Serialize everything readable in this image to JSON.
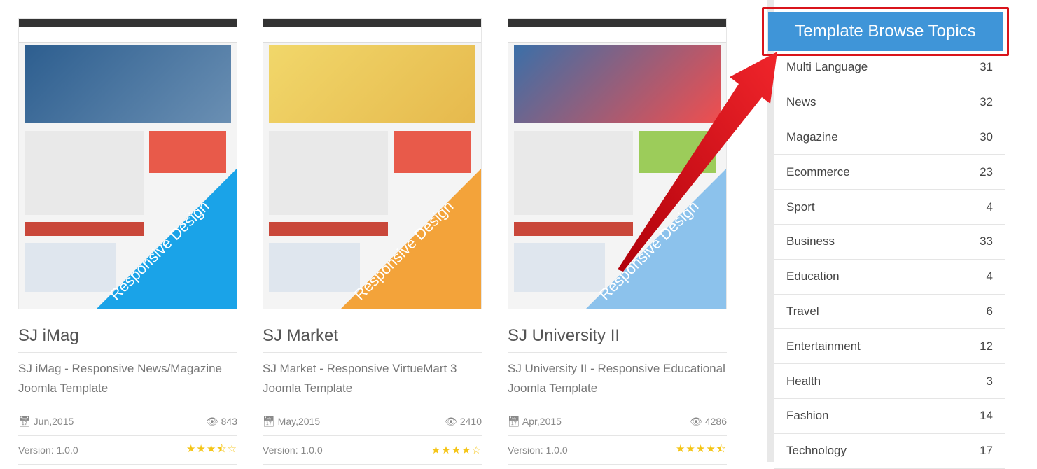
{
  "templates": [
    {
      "title": "SJ iMag",
      "description": "SJ iMag - Responsive News/Magazine Joomla Template",
      "date": "Jun,2015",
      "views": "843",
      "version": "Version: 1.0.0",
      "rating": 3.5,
      "badge": "Responsive Design",
      "badge_color": "#1aa3e8"
    },
    {
      "title": "SJ Market",
      "description": "SJ Market - Responsive VirtueMart 3 Joomla Template",
      "date": "May,2015",
      "views": "2410",
      "version": "Version: 1.0.0",
      "rating": 4,
      "badge": "Responsive Design",
      "badge_color": "#f3a33a"
    },
    {
      "title": "SJ University II",
      "description": "SJ University II - Responsive Educational Joomla Template",
      "date": "Apr,2015",
      "views": "4286",
      "version": "Version: 1.0.0",
      "rating": 4.5,
      "badge": "Responsive Design",
      "badge_color": "#8cc2ec"
    }
  ],
  "sidebar": {
    "title": "Template Browse Topics",
    "topics": [
      {
        "label": "Multi Language",
        "count": "31"
      },
      {
        "label": "News",
        "count": "32"
      },
      {
        "label": "Magazine",
        "count": "30"
      },
      {
        "label": "Ecommerce",
        "count": "23"
      },
      {
        "label": "Sport",
        "count": "4"
      },
      {
        "label": "Business",
        "count": "33"
      },
      {
        "label": "Education",
        "count": "4"
      },
      {
        "label": "Travel",
        "count": "6"
      },
      {
        "label": "Entertainment",
        "count": "12"
      },
      {
        "label": "Health",
        "count": "3"
      },
      {
        "label": "Fashion",
        "count": "14"
      },
      {
        "label": "Technology",
        "count": "17"
      }
    ]
  },
  "colors": {
    "accent": "#3f95d8",
    "highlight": "#d9141b",
    "star": "#f5c518"
  }
}
